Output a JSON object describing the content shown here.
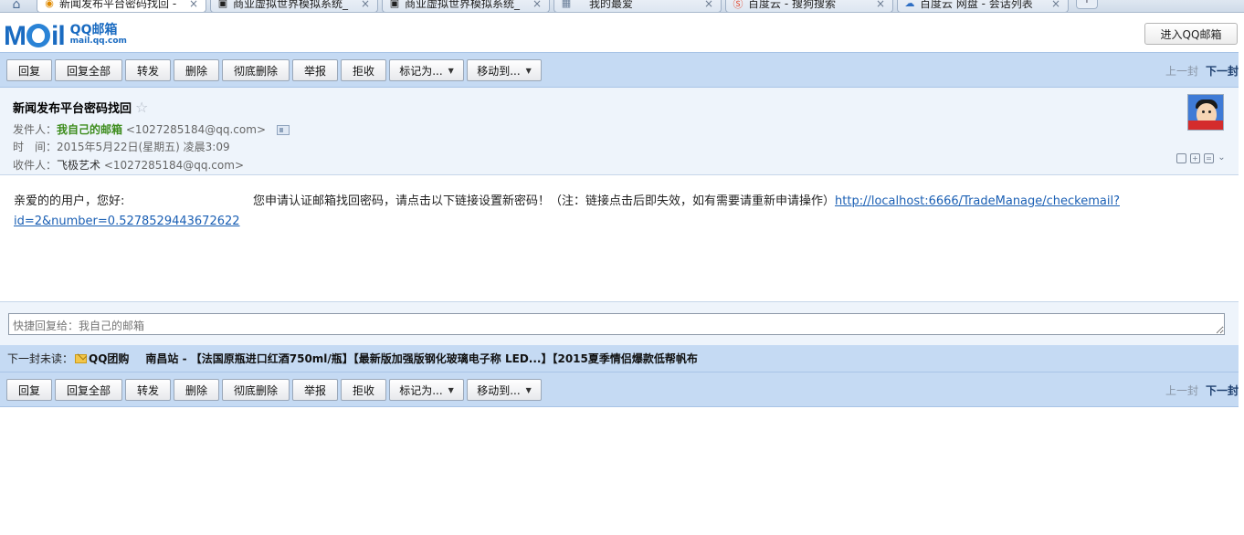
{
  "browser": {
    "tabs": [
      {
        "title": "新闻发布平台密码找回 -",
        "icon": "qq-mail-icon",
        "active": true
      },
      {
        "title": "商业虚拟世界模拟系统_",
        "icon": "page-icon",
        "active": false
      },
      {
        "title": "商业虚拟世界模拟系统_",
        "icon": "page-icon",
        "active": false
      },
      {
        "title": "我的最爱",
        "icon": "grid-icon",
        "active": false
      },
      {
        "title": "百度云 - 搜狗搜索",
        "icon": "sogou-icon",
        "active": false
      },
      {
        "title": "百度云 网盘 - 会话列表",
        "icon": "baidu-cloud-icon",
        "active": false
      }
    ],
    "close_glyph": "×",
    "new_tab_glyph": "+"
  },
  "header": {
    "logo_qq": "QQ邮箱",
    "logo_url": "mail.qq.com",
    "logo_word": "Mail",
    "enter_button": "进入QQ邮箱"
  },
  "toolbar": {
    "reply": "回复",
    "reply_all": "回复全部",
    "forward": "转发",
    "delete": "删除",
    "delete_permanently": "彻底删除",
    "report": "举报",
    "reject": "拒收",
    "mark_as": "标记为...",
    "move_to": "移动到...",
    "prev": "上一封",
    "next": "下一封"
  },
  "mail": {
    "subject": "新闻发布平台密码找回",
    "from_label": "发件人：",
    "from_name": "我自己的邮箱",
    "from_address": "<1027285184@qq.com>",
    "time_label": "时　间：",
    "time_value": "2015年5月22日(星期五) 凌晨3:09",
    "to_label": "收件人：",
    "to_name": "飞极艺术",
    "to_address": "<1027285184@qq.com>",
    "greeting": "亲爱的的用户，您好:",
    "body_text": "您申请认证邮箱找回密码，请点击以下链接设置新密码！（注：链接点击后即失效，如有需要请重新申请操作）",
    "link": "http://localhost:6666/TradeManage/checkemail?id=2&number=0.5278529443672622"
  },
  "quick_reply": {
    "placeholder": "快捷回复给：我自己的邮箱"
  },
  "next_unread": {
    "label": "下一封未读：",
    "sender": "QQ团购",
    "subject": "南昌站 - 【法国原瓶进口红酒750ml/瓶】【最新版加强版钢化玻璃电子称 LED...】【2015夏季情侣爆款低帮帆布"
  }
}
